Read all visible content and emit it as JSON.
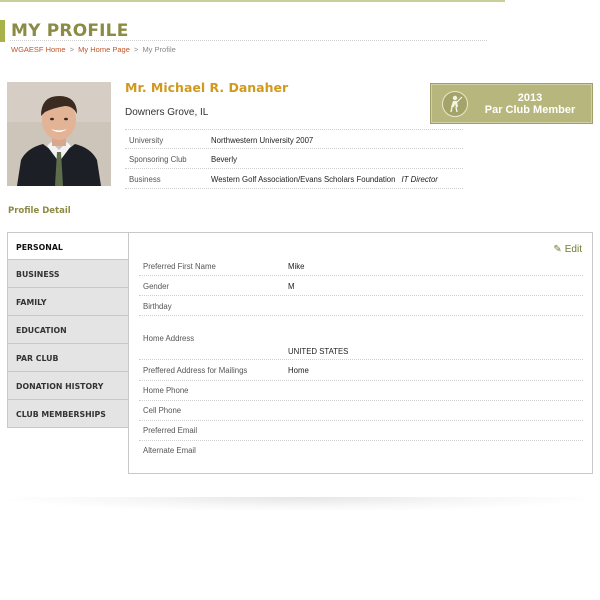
{
  "page": {
    "title": "MY PROFILE"
  },
  "breadcrumb": {
    "items": [
      "WGAESF Home",
      "My Home Page",
      "My Profile"
    ],
    "separator": ">"
  },
  "profile": {
    "name": "Mr. Michael R. Danaher",
    "location": "Downers Grove, IL",
    "info": [
      {
        "label": "University",
        "value": "Northwestern University 2007",
        "extra": ""
      },
      {
        "label": "Sponsoring Club",
        "value": "Beverly",
        "extra": ""
      },
      {
        "label": "Business",
        "value": "Western Golf Association/Evans Scholars Foundation",
        "extra": "IT Director"
      }
    ]
  },
  "badge": {
    "year": "2013",
    "label": "Par Club Member",
    "icon": "golfer-icon"
  },
  "section": {
    "title": "Profile Detail"
  },
  "tabs": [
    {
      "label": "PERSONAL",
      "active": true
    },
    {
      "label": "BUSINESS",
      "active": false
    },
    {
      "label": "FAMILY",
      "active": false
    },
    {
      "label": "EDUCATION",
      "active": false
    },
    {
      "label": "PAR CLUB",
      "active": false
    },
    {
      "label": "DONATION HISTORY",
      "active": false
    },
    {
      "label": "CLUB MEMBERSHIPS",
      "active": false
    }
  ],
  "detail": {
    "edit_label": "Edit",
    "edit_icon": "pencil-icon",
    "rows": [
      {
        "label": "Preferred First Name",
        "value": "Mike"
      },
      {
        "label": "Gender",
        "value": "M"
      },
      {
        "label": "Birthday",
        "value": ""
      },
      {
        "label": "Home Address",
        "value": "UNITED STATES"
      },
      {
        "label": "Preffered Address for Mailings",
        "value": "Home"
      },
      {
        "label": "Home Phone",
        "value": ""
      },
      {
        "label": "Cell Phone",
        "value": ""
      },
      {
        "label": "Preferred Email",
        "value": ""
      },
      {
        "label": "Alternate Email",
        "value": ""
      }
    ]
  },
  "colors": {
    "title": "#8b8b45",
    "accent_bar": "#a8b24a",
    "name": "#d19a1e",
    "link": "#c0562a",
    "badge_bg": "#b7b77d",
    "edit": "#6a7d2e"
  }
}
